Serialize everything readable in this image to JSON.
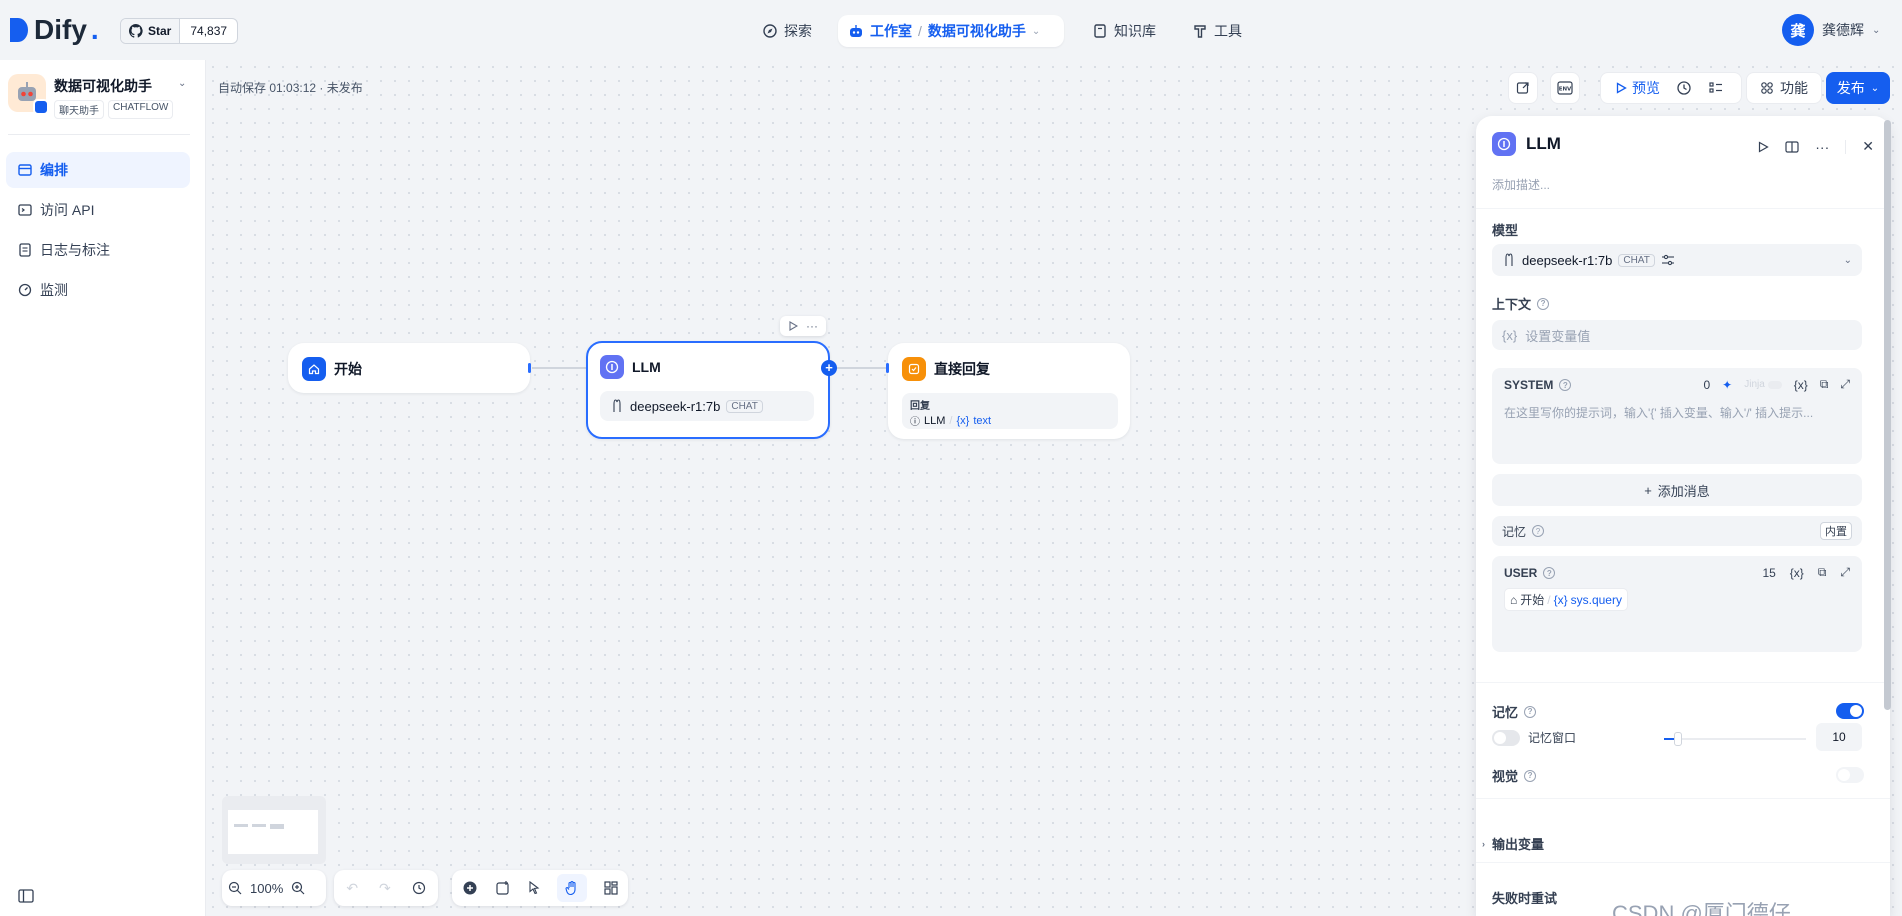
{
  "header": {
    "logo": "Dify",
    "github": {
      "label": "Star",
      "count": "74,837"
    },
    "nav": [
      {
        "label": "探索"
      },
      {
        "label": "工作室",
        "sub": "数据可视化助手"
      },
      {
        "label": "知识库"
      },
      {
        "label": "工具"
      }
    ],
    "user": {
      "avatar": "龚",
      "name": "龚德辉"
    }
  },
  "sidebar": {
    "app_name": "数据可视化助手",
    "tags": [
      "聊天助手",
      "CHATFLOW"
    ],
    "items": [
      {
        "label": "编排",
        "active": true
      },
      {
        "label": "访问 API"
      },
      {
        "label": "日志与标注"
      },
      {
        "label": "监测"
      }
    ]
  },
  "canvas": {
    "autosave": "自动保存 01:03:12 · 未发布",
    "nodes": {
      "start": {
        "title": "开始"
      },
      "llm": {
        "title": "LLM",
        "model": "deepseek-r1:7b",
        "mode": "CHAT"
      },
      "answer": {
        "title": "直接回复",
        "label": "回复",
        "var_node": "LLM",
        "var_name": "text"
      }
    },
    "zoom": "100%"
  },
  "toolbar": {
    "preview": "预览",
    "features": "功能",
    "publish": "发布"
  },
  "panel": {
    "title": "LLM",
    "description_placeholder": "添加描述...",
    "model_label": "模型",
    "model": "deepseek-r1:7b",
    "model_mode": "CHAT",
    "context_label": "上下文",
    "context_placeholder": "设置变量值",
    "system": {
      "label": "SYSTEM",
      "count": "0",
      "jinja": "Jinja",
      "placeholder": "在这里写你的提示词，输入'{' 插入变量、输入'/' 插入提示..."
    },
    "add_message": "添加消息",
    "memory_row": {
      "label": "记忆",
      "badge": "内置"
    },
    "user": {
      "label": "USER",
      "count": "15",
      "var_node": "开始",
      "var_name": "sys.query"
    },
    "memory": {
      "label": "记忆",
      "enabled": true
    },
    "memory_window": {
      "label": "记忆窗口",
      "value": "10",
      "enabled": false
    },
    "vision": {
      "label": "视觉",
      "enabled": false
    },
    "output_vars": "输出变量",
    "retry": "失败时重试"
  },
  "watermark": "CSDN @厦门德仔",
  "colors": {
    "accent": "#155eef",
    "start": "#155eef",
    "llm": "#6172f3",
    "answer": "#f79009"
  }
}
